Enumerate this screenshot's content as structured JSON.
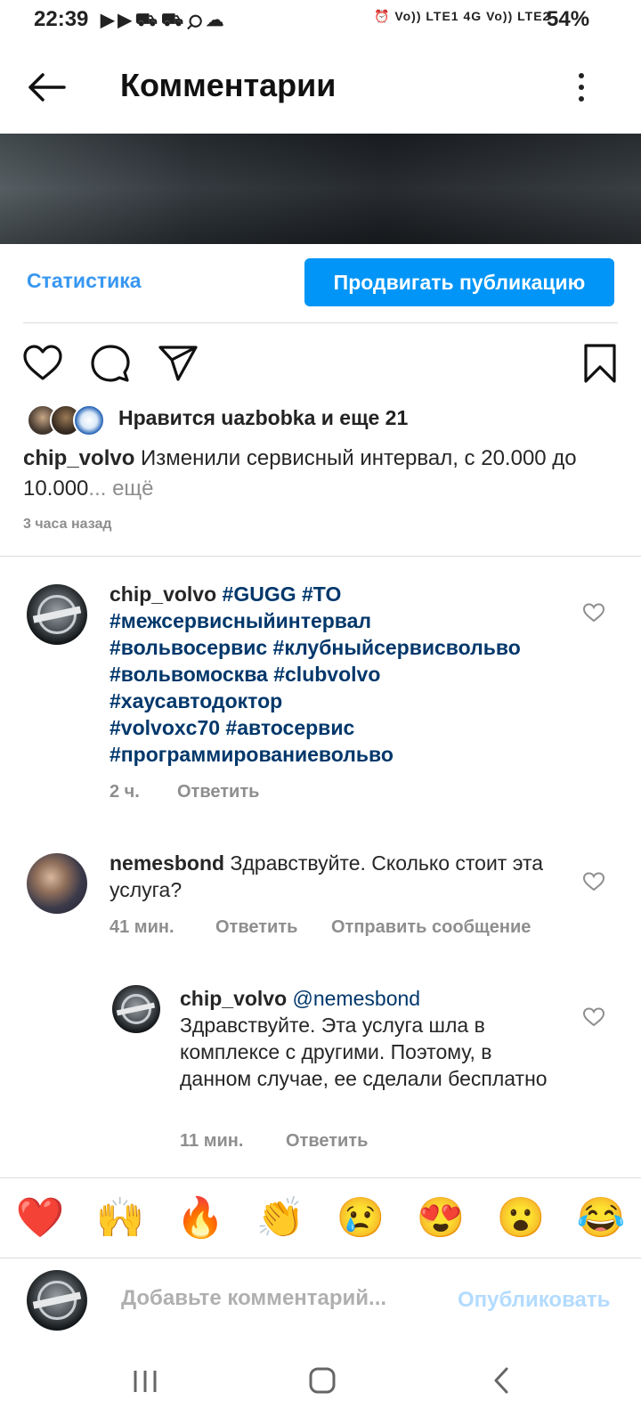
{
  "status_bar": {
    "time": "22:39",
    "battery": "54%",
    "net1": "Vo)) LTE1",
    "net2": "4G",
    "net3": "Vo)) LTE2"
  },
  "header": {
    "title": "Комментарии"
  },
  "post": {
    "stats_label": "Статистика",
    "promote_label": "Продвигать публикацию",
    "likes_text": "Нравится uazbobka и еще 21",
    "caption_user": "chip_volvo",
    "caption_text": " Изменили сервисный интервал, с 20.000 до 10.000",
    "caption_more": "... ещё",
    "time_ago": "3 часа назад"
  },
  "comments": [
    {
      "user": "chip_volvo",
      "tags": [
        "#GUGG",
        "#TO",
        "#межсервисныйинтервал",
        "#вольвосервис",
        "#клубныйсервисвольво",
        "#вольвомосква",
        "#clubvolvo",
        "#хаусавтодоктор",
        "#volvoxc70",
        "#автосервис",
        "#программированиевольво"
      ],
      "time": "2 ч.",
      "reply_label": "Ответить"
    },
    {
      "user": "nemesbond",
      "text": " Здравствуйте. Сколько стоит эта услуга?",
      "time": "41 мин.",
      "reply_label": "Ответить",
      "message_label": "Отправить сообщение"
    },
    {
      "user": "chip_volvo",
      "mention": "@nemesbond",
      "text": "Здравствуйте. Эта услуга шла в комплексе с другими. Поэтому, в данном случае, ее сделали бесплатно",
      "time": "11 мин.",
      "reply_label": "Ответить"
    }
  ],
  "emoji_bar": [
    "❤️",
    "🙌",
    "🔥",
    "👏",
    "😢",
    "😍",
    "😮",
    "😂"
  ],
  "composer": {
    "placeholder": "Добавьте комментарий...",
    "publish_label": "Опубликовать"
  },
  "colors": {
    "link": "#3897f0",
    "button": "#0095f6",
    "hashtag": "#00376b",
    "muted": "#8e8e8e"
  }
}
